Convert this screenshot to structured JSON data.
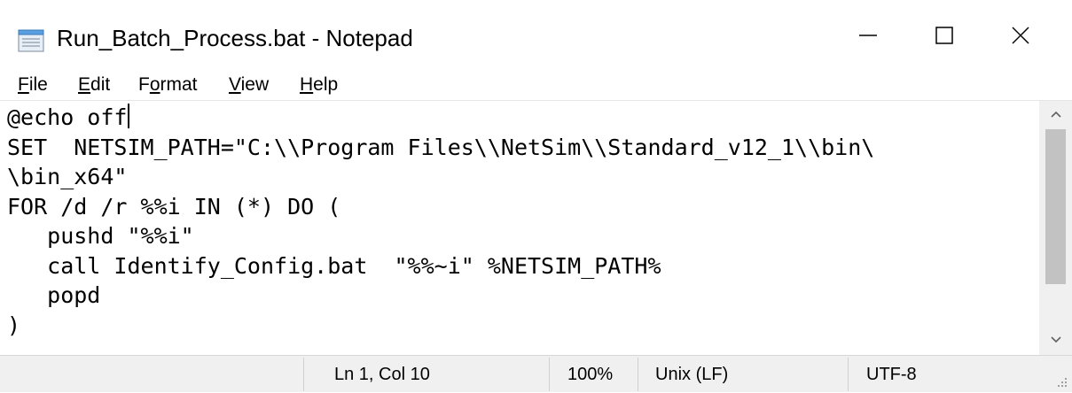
{
  "window": {
    "title": "Run_Batch_Process.bat - Notepad"
  },
  "menu": {
    "file": {
      "underlined": "F",
      "rest": "ile"
    },
    "edit": {
      "underlined": "E",
      "rest": "dit"
    },
    "format": {
      "pre": "F",
      "underlined": "o",
      "rest": "rmat"
    },
    "view": {
      "underlined": "V",
      "rest": "iew"
    },
    "help": {
      "underlined": "H",
      "rest": "elp"
    }
  },
  "editor": {
    "line1": "@echo off",
    "rest": "SET  NETSIM_PATH=\"C:\\\\Program Files\\\\NetSim\\\\Standard_v12_1\\\\bin\\\n\\bin_x64\"\nFOR /d /r %%i IN (*) DO (\n   pushd \"%%i\"\n   call Identify_Config.bat  \"%%~i\" %NETSIM_PATH%\n   popd\n)"
  },
  "status": {
    "position": "Ln 1, Col 10",
    "zoom": "100%",
    "line_ending": "Unix (LF)",
    "encoding": "UTF-8"
  }
}
